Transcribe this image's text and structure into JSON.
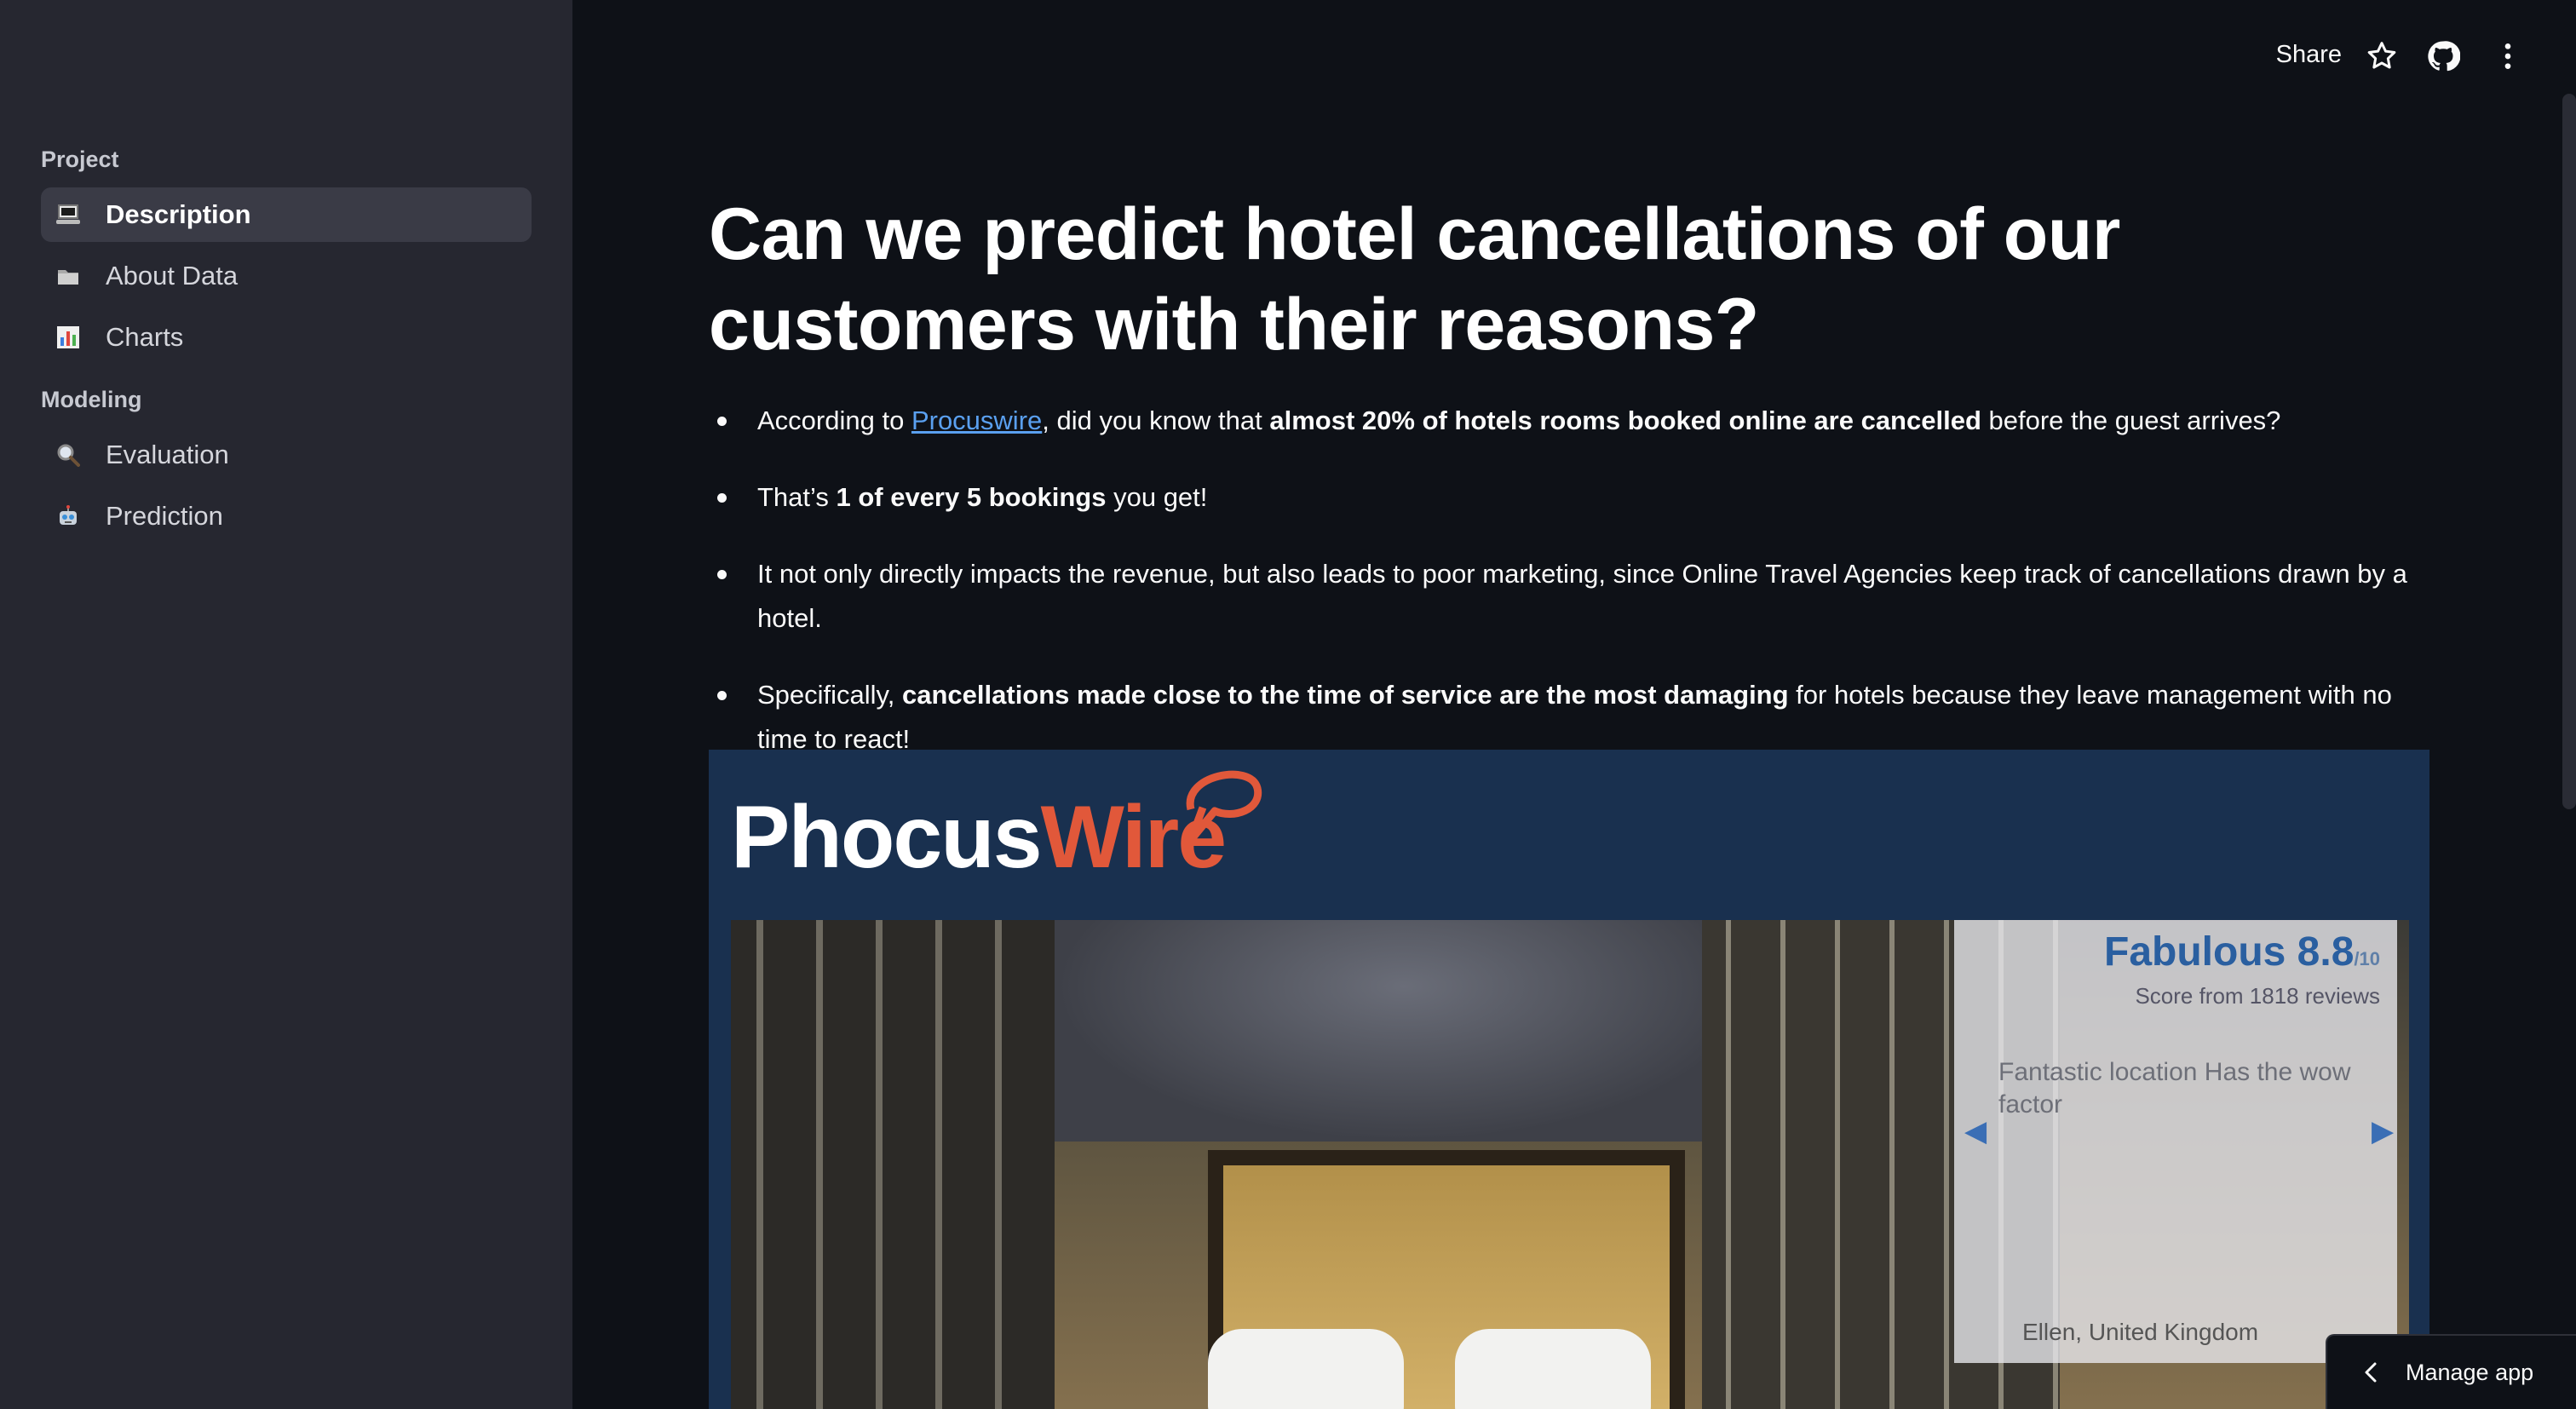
{
  "sidebar": {
    "sections": [
      {
        "label": "Project",
        "items": [
          {
            "label": "Description",
            "icon": "laptop-icon",
            "active": true
          },
          {
            "label": "About Data",
            "icon": "folder-icon",
            "active": false
          },
          {
            "label": "Charts",
            "icon": "bar-chart-icon",
            "active": false
          }
        ]
      },
      {
        "label": "Modeling",
        "items": [
          {
            "label": "Evaluation",
            "icon": "magnifier-icon",
            "active": false
          },
          {
            "label": "Prediction",
            "icon": "robot-icon",
            "active": false
          }
        ]
      }
    ]
  },
  "header": {
    "share_label": "Share",
    "icons": [
      "star-icon",
      "github-icon",
      "more-vertical-icon"
    ]
  },
  "main": {
    "title": "Can we predict hotel cancellations of our customers with their reasons?",
    "bullets": {
      "b1_pre": "According to ",
      "b1_link": "Procuswire",
      "b1_mid": ", did you know that ",
      "b1_bold": "almost 20% of hotels rooms booked online are cancelled",
      "b1_post": " before the guest arrives?",
      "b2_pre": "That’s ",
      "b2_bold": "1 of every 5 bookings",
      "b2_post": " you get!",
      "b3": "It not only directly impacts the revenue, but also leads to poor marketing, since Online Travel Agencies keep track of cancellations drawn by a hotel.",
      "b4_pre": "Specifically, ",
      "b4_bold": "cancellations made close to the time of service are the most damaging",
      "b4_post": " for hotels because they leave management with no time to react!"
    },
    "image": {
      "logo_part1": "Phocus",
      "logo_part2": "Wire",
      "review_score": "Fabulous 8.8",
      "review_score_suffix": "/10",
      "review_sub": "Score from 1818 reviews",
      "review_quote": "Fantastic location Has the wow factor",
      "reviewer": "Ellen, United Kingdom"
    }
  },
  "manage_app": {
    "label": "Manage app"
  },
  "colors": {
    "accent_link": "#5aa0f0",
    "phocuswire_orange": "#e1583a",
    "sidebar_bg": "#262730",
    "main_bg": "#0e1117"
  }
}
